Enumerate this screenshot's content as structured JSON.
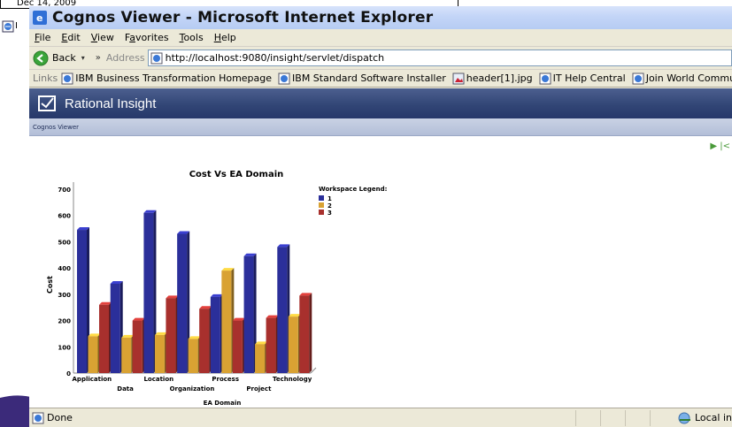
{
  "background": {
    "note_text": "Dec 14, 2009",
    "letter": "I"
  },
  "window": {
    "title": "Cognos Viewer - Microsoft Internet Explorer"
  },
  "menu": [
    {
      "label": "File",
      "key": "F"
    },
    {
      "label": "Edit",
      "key": "E"
    },
    {
      "label": "View",
      "key": "V"
    },
    {
      "label": "Favorites",
      "key": "a"
    },
    {
      "label": "Tools",
      "key": "T"
    },
    {
      "label": "Help",
      "key": "H"
    }
  ],
  "toolbar": {
    "back_label": "Back",
    "chevron": "»",
    "address_label": "Address",
    "address_value": "http://localhost:9080/insight/servlet/dispatch"
  },
  "links": {
    "label": "Links",
    "items": [
      {
        "label": "IBM Business Transformation Homepage",
        "icon": "ie-page-icon"
      },
      {
        "label": "IBM Standard Software Installer",
        "icon": "ie-page-icon"
      },
      {
        "label": "header[1].jpg",
        "icon": "image-file-icon"
      },
      {
        "label": "IT Help Central",
        "icon": "ie-page-icon"
      },
      {
        "label": "Join World Community Grid",
        "icon": "ie-page-icon"
      }
    ]
  },
  "app": {
    "product": "Rational Insight",
    "subheader": "Cognos Viewer",
    "viewer_controls": "▶ |<"
  },
  "chart_data": {
    "type": "bar",
    "title": "Cost Vs EA Domain",
    "xlabel": "EA Domain",
    "ylabel": "Cost",
    "ylim": [
      0,
      700
    ],
    "yticks": [
      0,
      100,
      200,
      300,
      400,
      500,
      600,
      700
    ],
    "categories": [
      "Application",
      "Data",
      "Location",
      "Organization",
      "Process",
      "Project",
      "Technology"
    ],
    "legend_title": "Workspace Legend:",
    "legend_position": "top-right",
    "series": [
      {
        "name": "1",
        "color": "#2b2f9a",
        "values": [
          545,
          340,
          610,
          530,
          290,
          445,
          480
        ]
      },
      {
        "name": "2",
        "color": "#d9a233",
        "values": [
          140,
          135,
          145,
          130,
          390,
          110,
          215
        ]
      },
      {
        "name": "3",
        "color": "#a8302d",
        "values": [
          260,
          200,
          285,
          245,
          200,
          210,
          295
        ]
      }
    ]
  },
  "status": {
    "left": "Done",
    "right": "Local in"
  }
}
